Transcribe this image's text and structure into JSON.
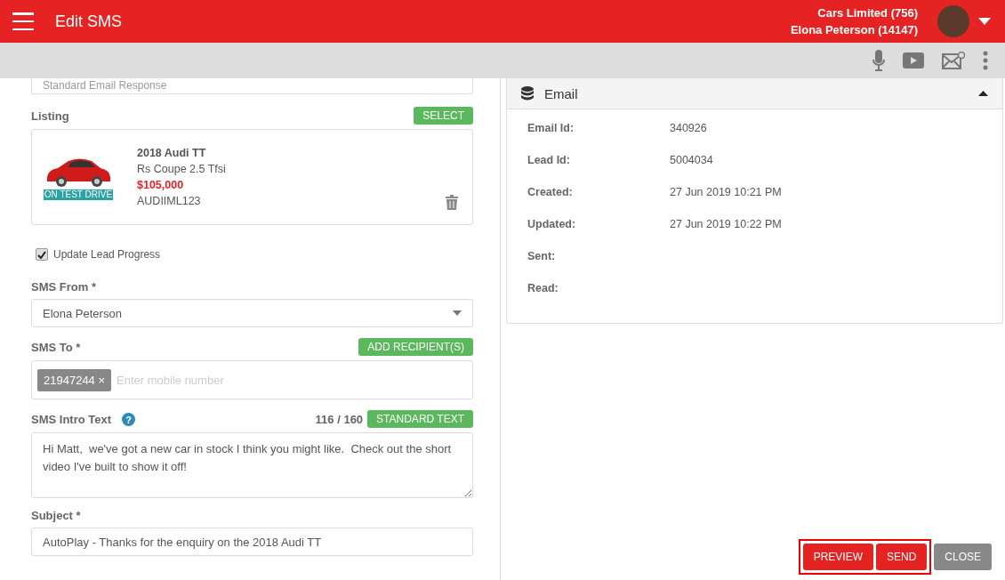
{
  "header": {
    "title": "Edit SMS",
    "company": "Cars Limited (756)",
    "user": "Elona Peterson (14147)"
  },
  "form": {
    "template_value": "Standard Email Response",
    "listing_label": "Listing",
    "select_button": "SELECT",
    "listing": {
      "badge": "ON TEST DRIVE",
      "title": "2018 Audi TT",
      "variant": "Rs Coupe 2.5 Tfsi",
      "price": "$105,000",
      "code": "AUDIIML123"
    },
    "update_lead": {
      "label": "Update Lead Progress",
      "checked": true
    },
    "from_label": "SMS From *",
    "from_value": "Elona Peterson",
    "to_label": "SMS To *",
    "add_button": "ADD RECIPIENT(S)",
    "recipients": [
      "21947244"
    ],
    "remove_glyph": "×",
    "to_placeholder": "Enter mobile number",
    "intro_label": "SMS Intro Text",
    "help_glyph": "?",
    "intro_count": "116 / 160",
    "standard_button": "STANDARD TEXT",
    "intro_value": "Hi Matt,  we've got a new car in stock I think you might like.  Check out the short video I've built to show it off!",
    "subject_label": "Subject *",
    "subject_value": "AutoPlay - Thanks for the enquiry on the 2018 Audi TT"
  },
  "panel": {
    "title": "Email",
    "expanded": true,
    "rows": [
      {
        "label": "Email Id:",
        "value": "340926"
      },
      {
        "label": "Lead Id:",
        "value": "5004034"
      },
      {
        "label": "Created:",
        "value": "27 Jun 2019 10:21 PM"
      },
      {
        "label": "Updated:",
        "value": "27 Jun 2019 10:22 PM"
      },
      {
        "label": "Sent:"
      },
      {
        "label": "Read:"
      }
    ]
  },
  "actions": [
    {
      "label": "PREVIEW",
      "kind": "primary",
      "highlighted": true
    },
    {
      "label": "SEND",
      "kind": "primary",
      "highlighted": true
    },
    {
      "label": "CLOSE",
      "kind": "secondary",
      "highlighted": false
    }
  ]
}
